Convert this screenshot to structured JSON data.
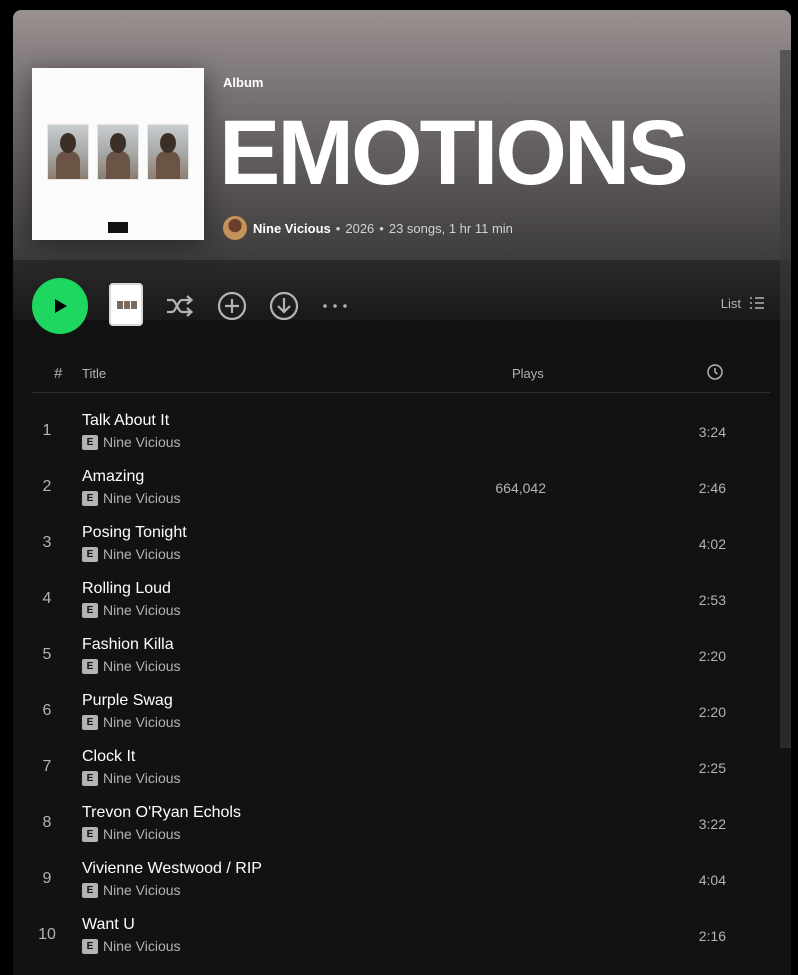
{
  "album": {
    "type_label": "Album",
    "title": "EMOTIONS",
    "artist": "Nine Vicious",
    "year": "2026",
    "summary": "23 songs, 1 hr 11 min",
    "cover_label": "PARENTAL ADVISORY EXPLICIT CONTENT"
  },
  "controls": {
    "view_label": "List"
  },
  "table": {
    "headers": {
      "num": "#",
      "title": "Title",
      "plays": "Plays"
    },
    "tracks": [
      {
        "num": "1",
        "title": "Talk About It",
        "explicit": "E",
        "artist": "Nine Vicious",
        "plays": "",
        "duration": "3:24"
      },
      {
        "num": "2",
        "title": "Amazing",
        "explicit": "E",
        "artist": "Nine Vicious",
        "plays": "664,042",
        "duration": "2:46"
      },
      {
        "num": "3",
        "title": "Posing Tonight",
        "explicit": "E",
        "artist": "Nine Vicious",
        "plays": "",
        "duration": "4:02"
      },
      {
        "num": "4",
        "title": "Rolling Loud",
        "explicit": "E",
        "artist": "Nine Vicious",
        "plays": "",
        "duration": "2:53"
      },
      {
        "num": "5",
        "title": "Fashion Killa",
        "explicit": "E",
        "artist": "Nine Vicious",
        "plays": "",
        "duration": "2:20"
      },
      {
        "num": "6",
        "title": "Purple Swag",
        "explicit": "E",
        "artist": "Nine Vicious",
        "plays": "",
        "duration": "2:20"
      },
      {
        "num": "7",
        "title": "Clock It",
        "explicit": "E",
        "artist": "Nine Vicious",
        "plays": "",
        "duration": "2:25"
      },
      {
        "num": "8",
        "title": "Trevon O'Ryan Echols",
        "explicit": "E",
        "artist": "Nine Vicious",
        "plays": "",
        "duration": "3:22"
      },
      {
        "num": "9",
        "title": "Vivienne Westwood / RIP",
        "explicit": "E",
        "artist": "Nine Vicious",
        "plays": "",
        "duration": "4:04"
      },
      {
        "num": "10",
        "title": "Want U",
        "explicit": "E",
        "artist": "Nine Vicious",
        "plays": "",
        "duration": "2:16"
      }
    ]
  },
  "colors": {
    "accent": "#1ed760",
    "background": "#121212",
    "text_muted": "#b3b3b3"
  },
  "icons": [
    "play-icon",
    "shuffle-icon",
    "add-circle-icon",
    "download-icon",
    "more-icon",
    "list-icon",
    "clock-icon"
  ]
}
